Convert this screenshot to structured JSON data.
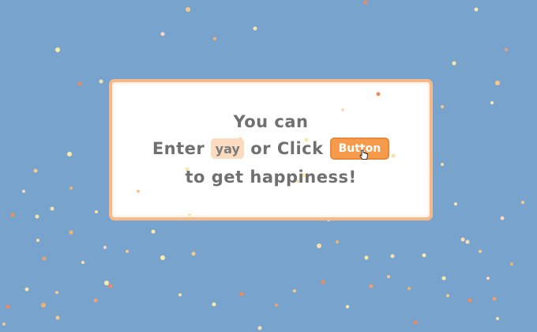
{
  "card": {
    "line1": "You can",
    "enter_label": "Enter",
    "input_value": "yay",
    "or_click_label": "or Click",
    "button_label": "Button",
    "line3": "to get happiness!"
  },
  "colors": {
    "background": "#78a3cd",
    "card_border": "#f5b98a",
    "button": "#f59b4b",
    "input_bg": "#fcdcc0",
    "text": "#707070"
  }
}
